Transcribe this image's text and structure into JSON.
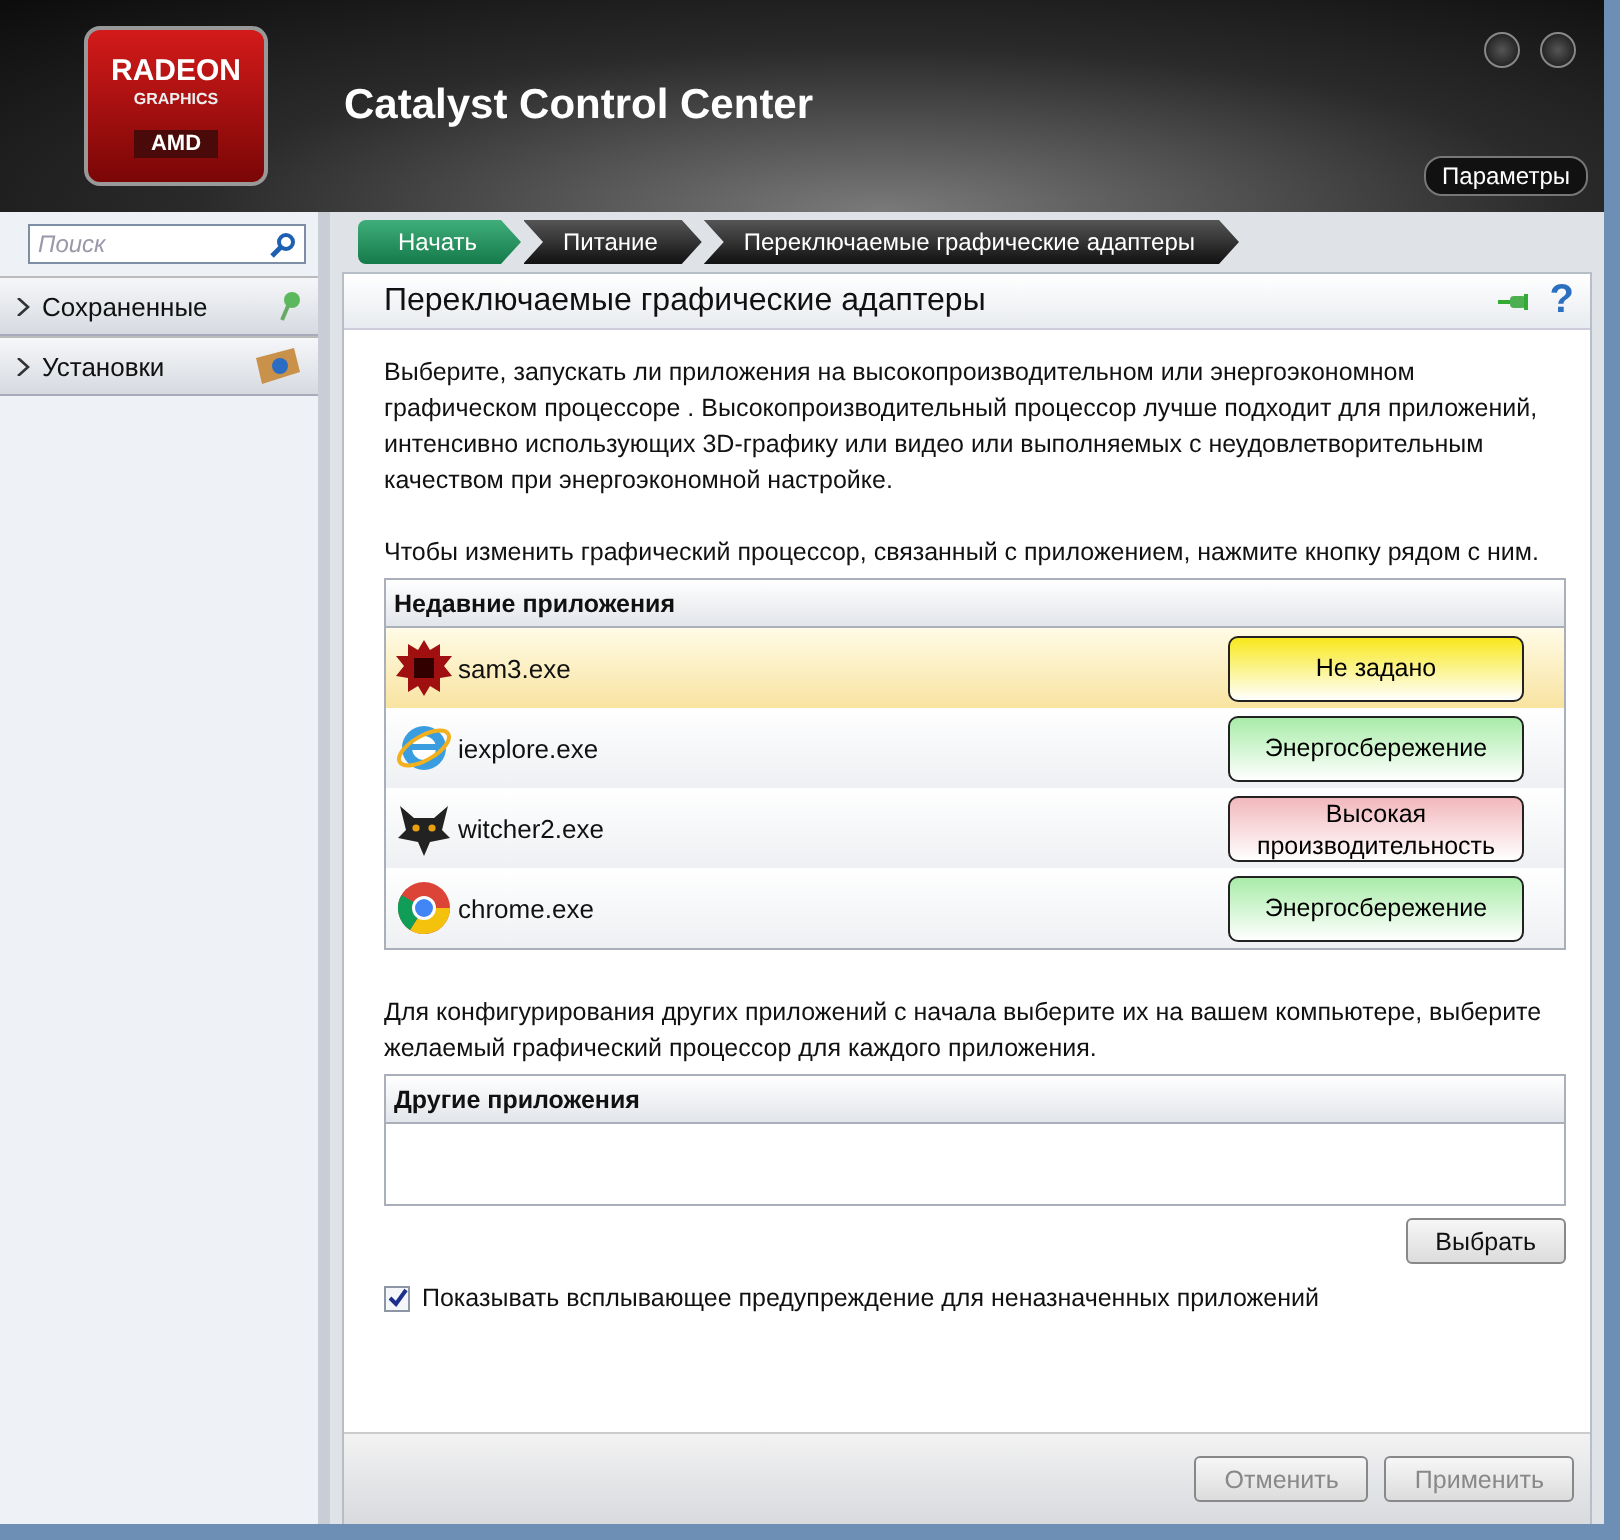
{
  "window": {
    "title": "Catalyst Control Center",
    "logo": {
      "line_1": "RADEON",
      "line_2": "GRAPHICS",
      "line_3": "AMD"
    },
    "options_button": "Параметры"
  },
  "sidebar": {
    "search": {
      "placeholder": "Поиск"
    },
    "items": [
      {
        "label": "Сохраненные",
        "expanded": false
      },
      {
        "label": "Установки",
        "expanded": false
      }
    ]
  },
  "breadcrumb": [
    {
      "label": "Начать",
      "selected": true
    },
    {
      "label": "Питание",
      "selected": false
    },
    {
      "label": "Переключаемые графические адаптеры",
      "selected": false
    }
  ],
  "page": {
    "title": "Переключаемые графические адаптеры",
    "help": "?",
    "intro": "Выберите, запускать ли приложения на высокопроизводительном или энергоэкономном графическом процессоре . Высокопроизводительный процессор лучше подходит для приложений, интенсивно использующих 3D-графику или видео или выполняемых с неудовлетворительным качеством при энергоэкономной настройке.",
    "hint": "Чтобы изменить графический процессор, связанный с приложением, нажмите кнопку рядом с ним.",
    "recent": {
      "heading": "Недавние приложения",
      "rows": [
        {
          "app": "sam3.exe",
          "color": "#f8e81c",
          "button": "Не задано",
          "selected": true
        },
        {
          "app": "iexplore.exe",
          "color": "#a8eca8",
          "button": "Энергосбережение",
          "selected": false
        },
        {
          "app": "witcher2.exe",
          "color": "#f2b8bc",
          "button": "Высокая производительность",
          "selected": false
        },
        {
          "app": "chrome.exe",
          "color": "#a8eca8",
          "button": "Энергосбережение",
          "selected": false
        }
      ]
    },
    "other_hint": "Для конфигурирования других приложений с начала выберите их на вашем компьютере, выберите желаемый графический процессор для каждого приложения.",
    "other": {
      "heading": "Другие приложения"
    },
    "choose_button": "Выбрать",
    "warning": {
      "label": "Показывать всплывающее предупреждение для неназначенных приложений",
      "checked": true
    }
  },
  "footer": {
    "buttons": [
      {
        "label": "Отменить",
        "disabled": true
      },
      {
        "label": "Применить",
        "disabled": true
      }
    ]
  }
}
